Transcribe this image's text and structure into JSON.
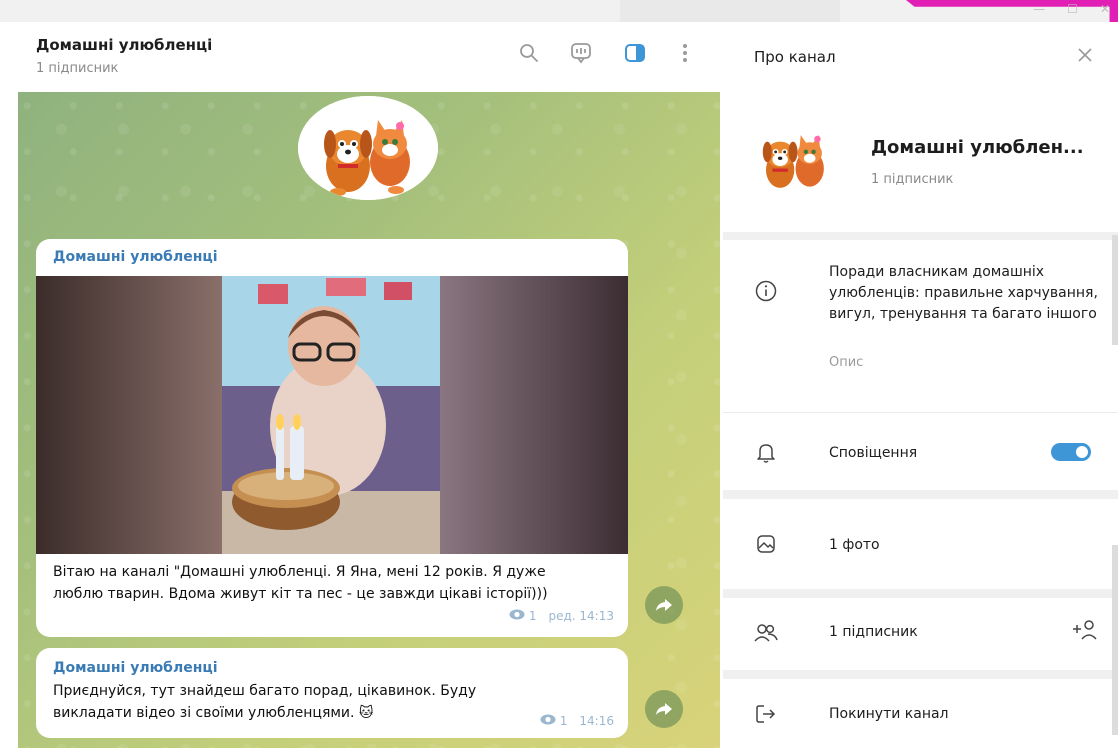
{
  "chat": {
    "title": "Домашні улюбленці",
    "subtitle": "1 підписник",
    "header_icons": [
      "search-icon",
      "live-stream-icon",
      "sidebar-toggle-icon",
      "more-vertical-icon"
    ]
  },
  "messages": [
    {
      "sender": "Домашні улюбленці",
      "text_line1": "Вітаю на каналі \"Домашні улюбленці. Я Яна, мені 12 років. Я дуже",
      "text_line2": "люблю тварин. Вдома живут кіт та пес - це завжди цікаві історії)))",
      "views": "1",
      "edited_time": "ред. 14:13",
      "has_photo": true
    },
    {
      "sender": "Домашні улюбленці",
      "text_line1": "Приєднуйся, тут знайдеш багато порад, цікавинок. Буду",
      "text_line2": "викладати відео зі своїми улюбленцями. 🐱",
      "views": "1",
      "time": "14:16"
    }
  ],
  "panel": {
    "title": "Про канал",
    "name": "Домашні улюблен...",
    "subscribers": "1 підписник",
    "about": "Поради власникам домашніх улюбленців: правильне харчування, вигул, тренування та багато іншого",
    "about_caption": "Опис",
    "notifications_label": "Сповіщення",
    "notifications_on": true,
    "photos_label": "1 фото",
    "members_label": "1 підписник",
    "leave_label": "Покинути канал"
  },
  "colors": {
    "accent": "#3f96d6",
    "link": "#3a7bb5",
    "brand_pink": "#e21fb4"
  }
}
